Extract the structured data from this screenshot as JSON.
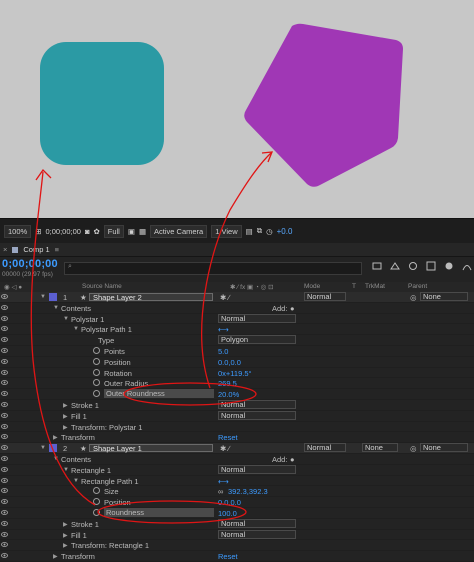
{
  "viewer": {
    "zoom": "100%",
    "timecode": "0;00;00;00",
    "resolution": "Full",
    "camera": "Active Camera",
    "views": "1 View",
    "exposure": "+0.0"
  },
  "tab": {
    "name": "Comp 1"
  },
  "timeline": {
    "timecode": "0;00;00;00",
    "fps": "00000 (29.97 fps)",
    "search_placeholder": "⌕"
  },
  "columns": {
    "source_name": "Source Name",
    "mode": "Mode",
    "t": "T",
    "trkmat": "TrkMat",
    "parent": "Parent"
  },
  "rows": [
    {
      "kind": "layer",
      "indent": 0,
      "num": "1",
      "name": "Shape Layer 2",
      "mode": "Normal",
      "parent": "None"
    },
    {
      "kind": "group",
      "indent": 1,
      "label": "Contents",
      "add": "Add:"
    },
    {
      "kind": "group",
      "indent": 2,
      "label": "Polystar 1",
      "value": "Normal"
    },
    {
      "kind": "group",
      "indent": 3,
      "label": "Polystar Path 1"
    },
    {
      "kind": "prop",
      "indent": 4,
      "label": "Type",
      "value": "Polygon",
      "select": true
    },
    {
      "kind": "prop",
      "indent": 4,
      "label": "Points",
      "value": "5.0",
      "sw": true
    },
    {
      "kind": "prop",
      "indent": 4,
      "label": "Position",
      "value": "0.0,0.0",
      "sw": true
    },
    {
      "kind": "prop",
      "indent": 4,
      "label": "Rotation",
      "value": "0x+119.5°",
      "sw": true
    },
    {
      "kind": "prop",
      "indent": 4,
      "label": "Outer Radius",
      "value": "269.5",
      "sw": true
    },
    {
      "kind": "prop",
      "indent": 4,
      "label": "Outer Roundness",
      "value": "20.0%",
      "sw": true,
      "hl": true
    },
    {
      "kind": "group",
      "indent": 2,
      "label": "Stroke 1",
      "value": "Normal"
    },
    {
      "kind": "group",
      "indent": 2,
      "label": "Fill 1",
      "value": "Normal"
    },
    {
      "kind": "group",
      "indent": 2,
      "label": "Transform: Polystar 1"
    },
    {
      "kind": "group",
      "indent": 1,
      "label": "Transform",
      "reset": "Reset"
    },
    {
      "kind": "layer",
      "indent": 0,
      "num": "2",
      "name": "Shape Layer 1",
      "mode": "Normal",
      "trkmat": "None",
      "parent": "None"
    },
    {
      "kind": "group",
      "indent": 1,
      "label": "Contents",
      "add": "Add:"
    },
    {
      "kind": "group",
      "indent": 2,
      "label": "Rectangle 1",
      "value": "Normal"
    },
    {
      "kind": "group",
      "indent": 3,
      "label": "Rectangle Path 1"
    },
    {
      "kind": "prop",
      "indent": 4,
      "label": "Size",
      "value": "392.3,392.3",
      "sw": true,
      "link": true
    },
    {
      "kind": "prop",
      "indent": 4,
      "label": "Position",
      "value": "0.0,0.0",
      "sw": true
    },
    {
      "kind": "prop",
      "indent": 4,
      "label": "Roundness",
      "value": "100.0",
      "sw": true,
      "hl": true
    },
    {
      "kind": "group",
      "indent": 2,
      "label": "Stroke 1",
      "value": "Normal"
    },
    {
      "kind": "group",
      "indent": 2,
      "label": "Fill 1",
      "value": "Normal"
    },
    {
      "kind": "group",
      "indent": 2,
      "label": "Transform: Rectangle 1"
    },
    {
      "kind": "group",
      "indent": 1,
      "label": "Transform",
      "reset": "Reset"
    }
  ],
  "colors": {
    "teal": "#2b9aa4",
    "purple": "#a037b5",
    "annotation": "#e01515",
    "accent": "#3d9bff"
  }
}
